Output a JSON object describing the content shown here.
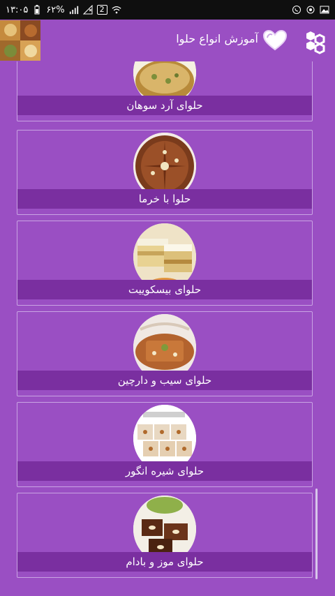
{
  "status_bar": {
    "time": "۱۳:۰۵",
    "battery": "۶۲%",
    "notification_count": "2"
  },
  "app_bar": {
    "title": "آموزش انواع حلوا"
  },
  "colors": {
    "primary": "#9a4fc3",
    "label_bg": "#7a2fa0",
    "card_border": "#c9a4e3"
  },
  "items": [
    {
      "label": "حلوای آرد سوهان"
    },
    {
      "label": "حلوا با خرما"
    },
    {
      "label": "حلوای بیسکوییت"
    },
    {
      "label": "حلوای سیب و دارچین"
    },
    {
      "label": "حلوای شیره انگور"
    },
    {
      "label": "حلوای موز و بادام"
    }
  ]
}
